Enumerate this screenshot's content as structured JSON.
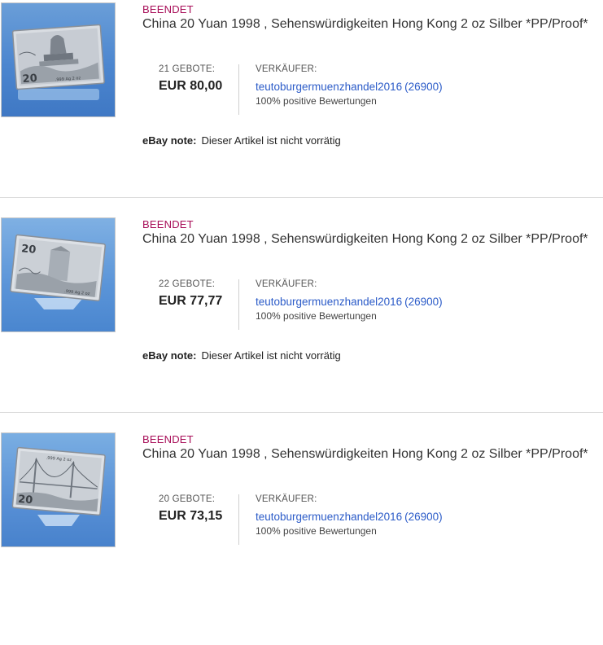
{
  "listings": [
    {
      "status": "BEENDET",
      "title": "China 20 Yuan 1998 , Sehenswürdigkeiten Hong Kong 2 oz Silber *PP/Proof*",
      "bids_label": "21 GEBOTE:",
      "price": "EUR 80,00",
      "seller_label": "VERKÄUFER:",
      "seller_name": "teutoburgermuenzhandel2016",
      "seller_rating": "(26900)",
      "feedback": "100% positive Bewertungen",
      "note_label": "eBay note:",
      "note_text": "Dieser Artikel ist nicht vorrätig",
      "coin_value": "20",
      "coin_mark": ".999 Ag 2 oz"
    },
    {
      "status": "BEENDET",
      "title": "China 20 Yuan 1998 , Sehenswürdigkeiten Hong Kong 2 oz Silber *PP/Proof*",
      "bids_label": "22 GEBOTE:",
      "price": "EUR 77,77",
      "seller_label": "VERKÄUFER:",
      "seller_name": "teutoburgermuenzhandel2016",
      "seller_rating": "(26900)",
      "feedback": "100% positive Bewertungen",
      "note_label": "eBay note:",
      "note_text": "Dieser Artikel ist nicht vorrätig",
      "coin_value": "20",
      "coin_mark": ".999 Ag 2 oz"
    },
    {
      "status": "BEENDET",
      "title": "China 20 Yuan 1998 , Sehenswürdigkeiten Hong Kong 2 oz Silber *PP/Proof*",
      "bids_label": "20 GEBOTE:",
      "price": "EUR 73,15",
      "seller_label": "VERKÄUFER:",
      "seller_name": "teutoburgermuenzhandel2016",
      "seller_rating": "(26900)",
      "feedback": "100% positive Bewertungen",
      "coin_value": "20",
      "coin_mark": ".999 Ag 2 oz"
    }
  ],
  "colors": {
    "status": "#a80e58",
    "link": "#2b5bc8",
    "separator": "#dddddd"
  }
}
